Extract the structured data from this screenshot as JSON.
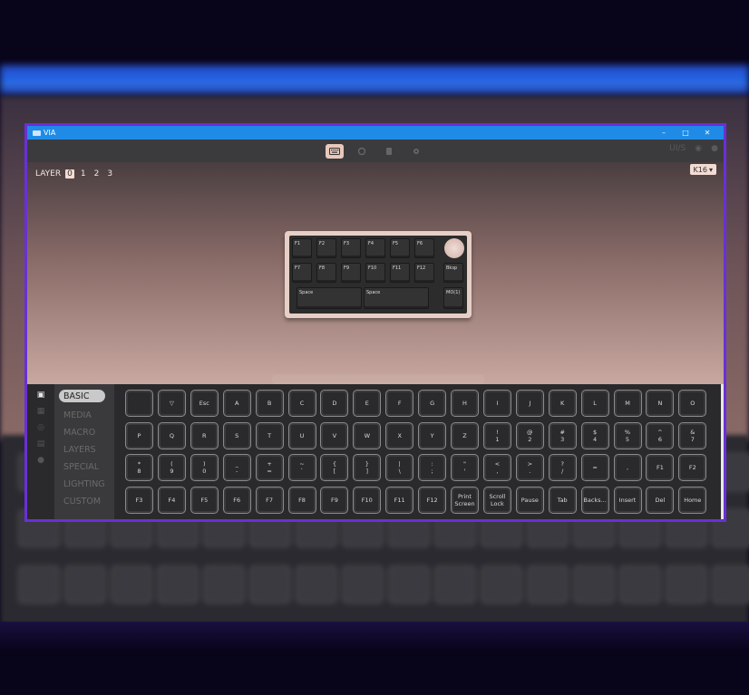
{
  "window": {
    "title": "VIA"
  },
  "titlebar_buttons": [
    "–",
    "□",
    "✕"
  ],
  "toolbar": {
    "icons": [
      "keyboard-icon",
      "settings-cog-icon",
      "test-icon",
      "gear-icon"
    ],
    "right": [
      "UI/S",
      "discord-icon",
      "github-icon"
    ]
  },
  "layers": {
    "label": "LAYER",
    "items": [
      "0",
      "1",
      "2",
      "3"
    ],
    "active": 0
  },
  "keyboard_select": {
    "value": "K16"
  },
  "preview_keys": {
    "row1": [
      "F1",
      "F2",
      "F3",
      "F4",
      "F5",
      "F6"
    ],
    "row2": [
      "F7",
      "F8",
      "F9",
      "F10",
      "F11",
      "F12"
    ],
    "row2_extra": "Bksp",
    "row3": [
      "Space",
      "Space"
    ],
    "row3_extra": "MO(1)"
  },
  "sidebar": {
    "categories": [
      "BASIC",
      "MEDIA",
      "MACRO",
      "LAYERS",
      "SPECIAL",
      "LIGHTING",
      "CUSTOM"
    ],
    "active": 0
  },
  "keycodes": {
    "rows": [
      [
        "",
        "▽",
        "Esc",
        "A",
        "B",
        "C",
        "D",
        "E",
        "F",
        "G",
        "H",
        "I",
        "J",
        "K",
        "L",
        "M",
        "N",
        "O"
      ],
      [
        "P",
        "Q",
        "R",
        "S",
        "T",
        "U",
        "V",
        "W",
        "X",
        "Y",
        "Z",
        "!\n1",
        "@\n2",
        "#\n3",
        "$\n4",
        "%\n5",
        "^\n6",
        "&\n7"
      ],
      [
        "*\n8",
        "(\n9",
        ")\n0",
        "_\n-",
        "+\n=",
        "~\n`",
        "{\n[",
        "}\n]",
        "|\n\\",
        ":\n;",
        "\"\n'",
        "<\n,",
        ">\n.",
        "?\n/",
        "=",
        ",",
        "F1",
        "F2"
      ],
      [
        "F3",
        "F4",
        "F5",
        "F6",
        "F7",
        "F8",
        "F9",
        "F10",
        "F11",
        "F12",
        "Print\nScreen",
        "Scroll\nLock",
        "Pause",
        "Tab",
        "Backs...",
        "Insert",
        "Del",
        "Home"
      ]
    ]
  }
}
